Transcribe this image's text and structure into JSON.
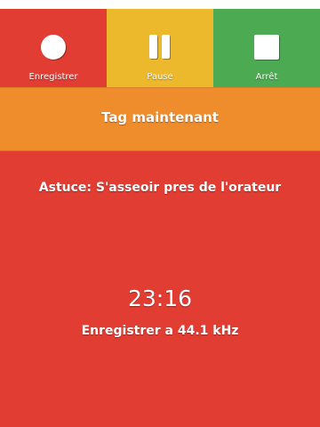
{
  "colors": {
    "background": "#e23d33",
    "record": "#e23d33",
    "pause": "#ebb92b",
    "stop": "#4caa52",
    "tag_bar": "#ef8c2b",
    "text": "#ffffff"
  },
  "toolbar": {
    "record": {
      "label": "Enregistrer",
      "icon": "record-circle-icon"
    },
    "pause": {
      "label": "Pause",
      "icon": "pause-icon"
    },
    "stop": {
      "label": "Arrêt",
      "icon": "stop-square-icon"
    }
  },
  "tag_button": {
    "label": "Tag maintenant"
  },
  "tip": "Astuce: S'asseoir pres de l'orateur",
  "timer": "23:16",
  "sample_rate": "Enregistrer a 44.1 kHz"
}
